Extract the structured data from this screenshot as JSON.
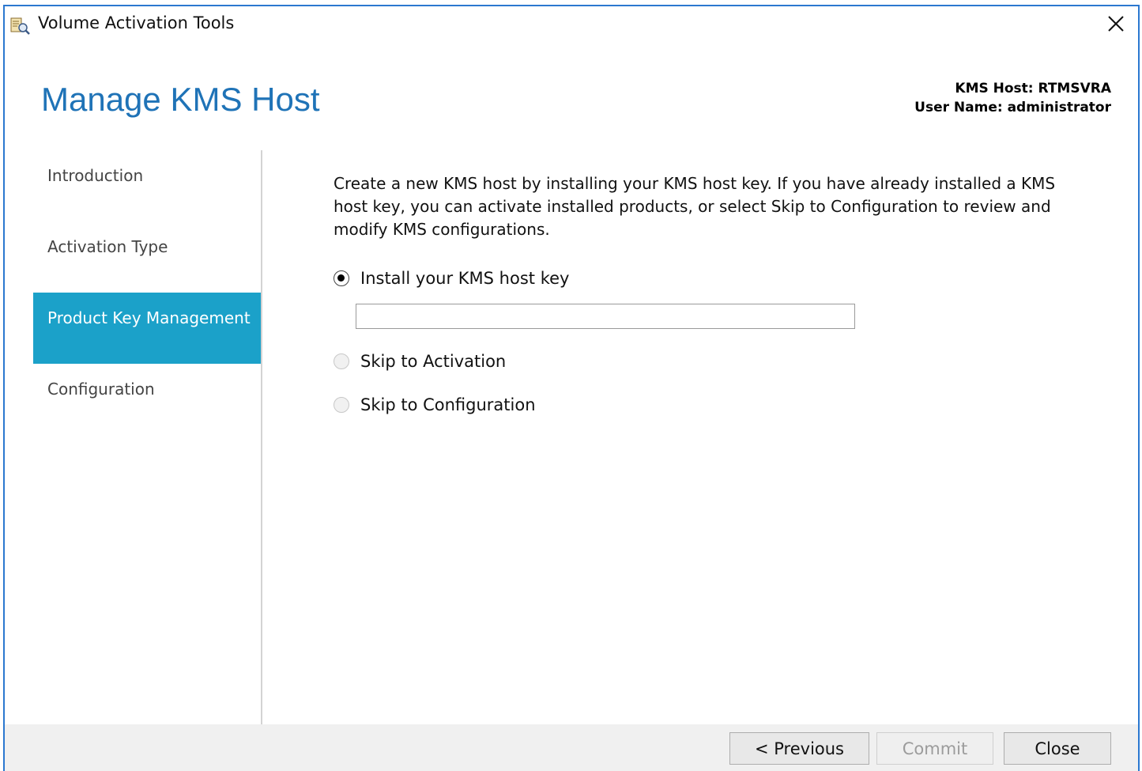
{
  "window": {
    "title": "Volume Activation Tools",
    "icons": {
      "app": "volume-activation-icon",
      "close": "close-icon"
    }
  },
  "header": {
    "page_title": "Manage KMS Host",
    "kms_host": "KMS Host: RTMSVRA",
    "user_name": "User Name: administrator"
  },
  "sidebar": {
    "items": [
      {
        "label": "Introduction",
        "active": false
      },
      {
        "label": "Activation Type",
        "active": false
      },
      {
        "label": "Product Key Management",
        "active": true
      },
      {
        "label": "Configuration",
        "active": false
      }
    ]
  },
  "main": {
    "description": "Create a new KMS host by installing your KMS host key. If you have already installed a KMS host key, you can activate installed products, or select Skip to Configuration to review and modify KMS configurations.",
    "options": [
      {
        "label": "Install your KMS host key",
        "checked": true
      },
      {
        "label": "Skip to Activation",
        "checked": false
      },
      {
        "label": "Skip to Configuration",
        "checked": false
      }
    ],
    "key_input": {
      "value": "",
      "placeholder": ""
    }
  },
  "footer": {
    "previous_label": "< Previous",
    "commit_label": "Commit",
    "close_label": "Close"
  },
  "colors": {
    "title_blue": "#1f73b7",
    "active_nav": "#1ba1c9",
    "window_border": "#2b78d0",
    "footer_bg": "#f0f0f0"
  }
}
